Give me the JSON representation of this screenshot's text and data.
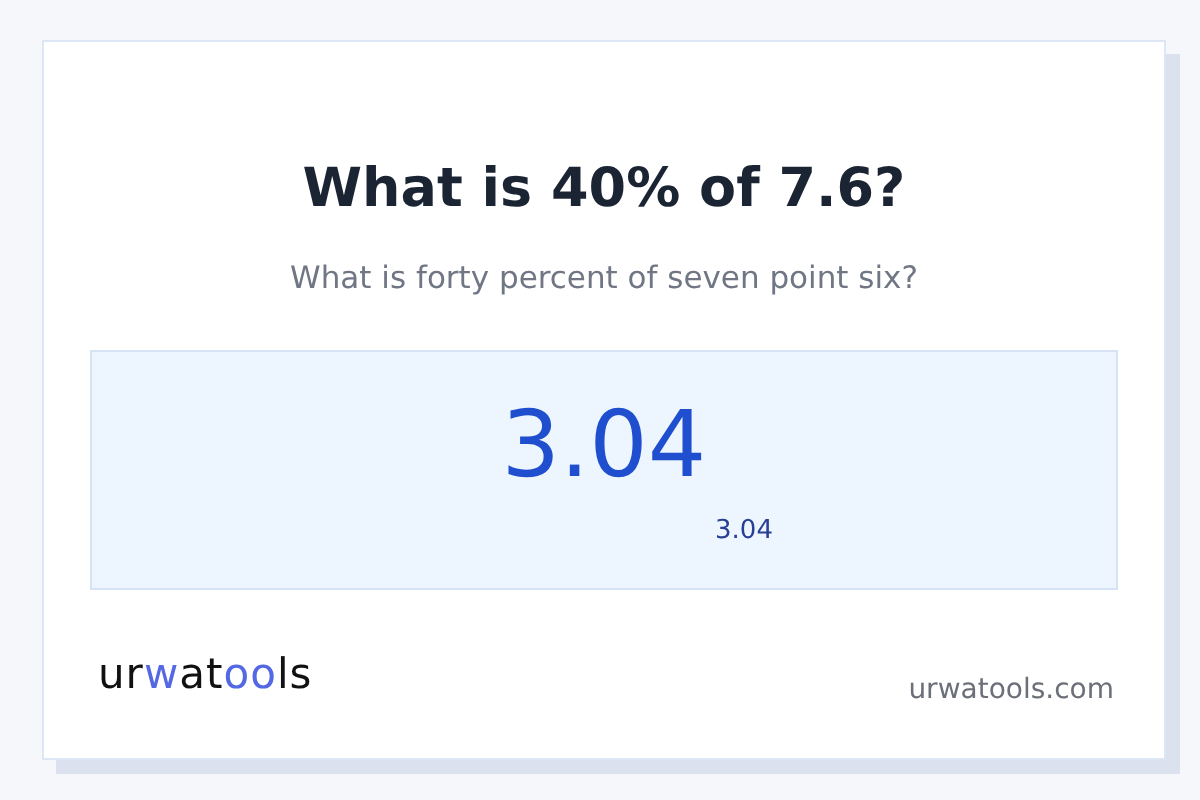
{
  "question": "What is 40% of 7.6?",
  "question_words": "What is forty percent of seven point six?",
  "result": {
    "value": "3.04",
    "note": "3.04"
  },
  "logo": {
    "parts": [
      {
        "text": "ur",
        "accent": false
      },
      {
        "text": "w",
        "accent": true
      },
      {
        "text": "at",
        "accent": false
      },
      {
        "text": "oo",
        "accent": true
      },
      {
        "text": "ls",
        "accent": false
      }
    ]
  },
  "site": "urwatools.com"
}
